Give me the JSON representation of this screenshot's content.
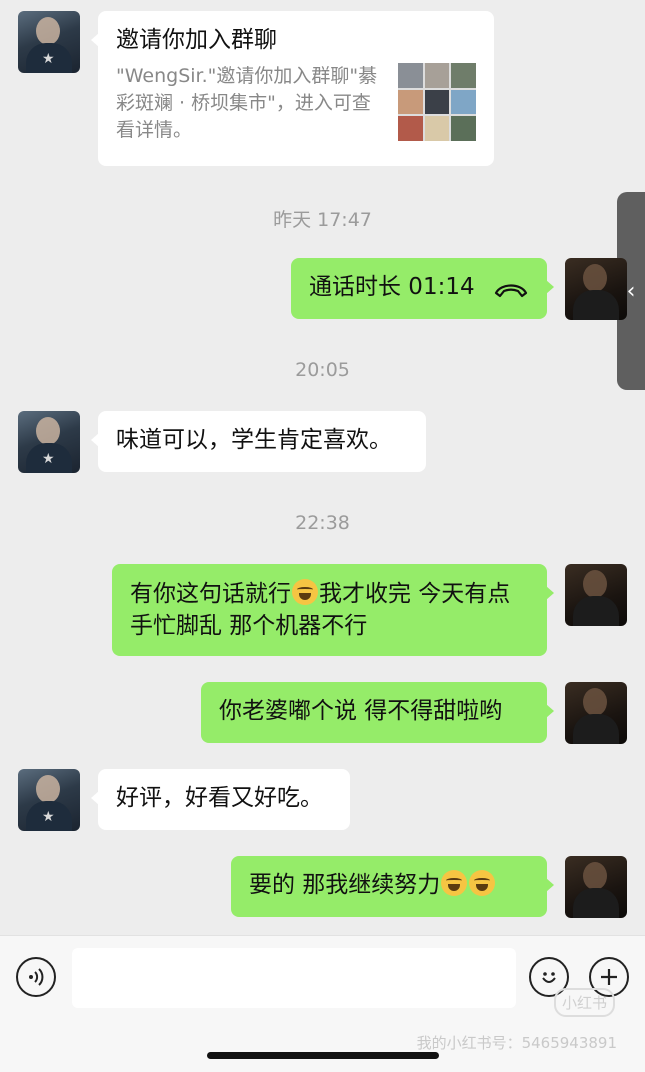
{
  "side_tab": {
    "icon": "chevron-left-icon",
    "glyph": "‹"
  },
  "invite": {
    "title": "邀请你加入群聊",
    "text": "\"WengSir.\"邀请你加入群聊\"綦彩斑斓 · 桥坝集市\"，进入可查看详情。"
  },
  "timestamps": [
    "昨天 17:47",
    "20:05",
    "22:38"
  ],
  "call": {
    "label": "通话时长 01:14",
    "icon": "phone-hangup-icon"
  },
  "messages": [
    {
      "text": "味道可以，学生肯定喜欢。"
    },
    {
      "text_part1": "有你这句话就行",
      "text_part2": "我才收完  今天有点手忙脚乱 那个机器不行"
    },
    {
      "text": "你老婆嘟个说 得不得甜啦哟"
    },
    {
      "text": "好评，好看又好吃。"
    },
    {
      "text": "要的 那我继续努力"
    }
  ],
  "input_bar": {
    "voice_icon": "voice-icon",
    "emoji_icon": "emoji-icon",
    "plus_icon": "plus-icon",
    "input_value": ""
  },
  "watermark": {
    "logo": "小红书",
    "text": "我的小红书号：5465943891"
  },
  "colors": {
    "outgoing_bubble": "#95ec69",
    "incoming_bubble": "#ffffff",
    "background": "#ededed"
  }
}
